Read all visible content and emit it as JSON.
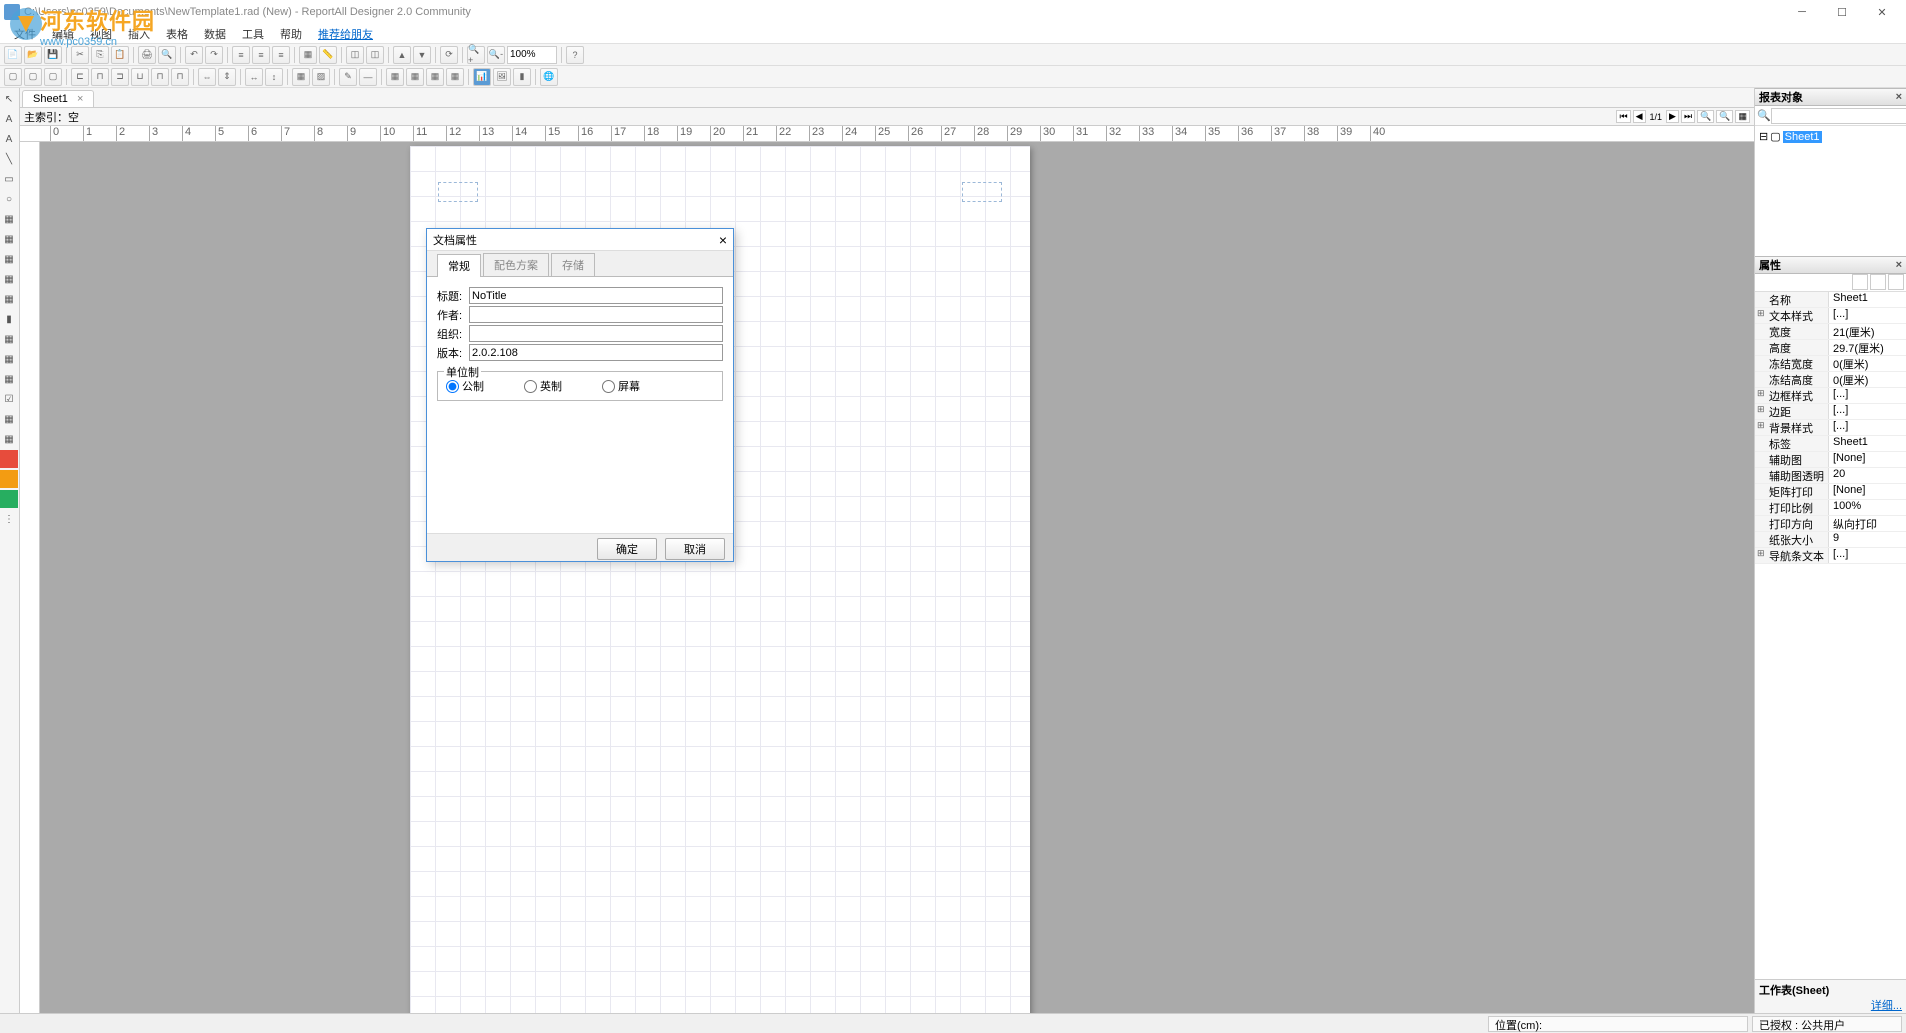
{
  "title": "C:\\Users\\pc0359\\Documents\\NewTemplate1.rad (New) - ReportAll Designer 2.0 Community",
  "watermark": {
    "line1": "河东软件园",
    "line2": "www.pc0359.cn"
  },
  "menu": {
    "file": "文件",
    "edit": "编辑",
    "view": "视图",
    "insert": "插入",
    "table": "表格",
    "data": "数据",
    "tool": "工具",
    "help": "帮助",
    "recommend": "推荐给朋友"
  },
  "toolbar": {
    "zoom": "100%"
  },
  "sheet_tab": "Sheet1",
  "index_bar": {
    "label": "主索引：",
    "value": "空",
    "page": "1/1"
  },
  "right": {
    "objects_title": "报表对象",
    "tree_root": "Sheet1",
    "props_title": "属性",
    "sheet_info": "工作表(Sheet)",
    "detail": "详细..."
  },
  "props": [
    {
      "k": "名称",
      "v": "Sheet1",
      "exp": false
    },
    {
      "k": "文本样式",
      "v": "[...]",
      "exp": true
    },
    {
      "k": "宽度",
      "v": "21(厘米)",
      "exp": false
    },
    {
      "k": "高度",
      "v": "29.7(厘米)",
      "exp": false
    },
    {
      "k": "冻结宽度",
      "v": "0(厘米)",
      "exp": false
    },
    {
      "k": "冻结高度",
      "v": "0(厘米)",
      "exp": false
    },
    {
      "k": "边框样式",
      "v": "[...]",
      "exp": true
    },
    {
      "k": "边距",
      "v": "[...]",
      "exp": true
    },
    {
      "k": "背景样式",
      "v": "[...]",
      "exp": true
    },
    {
      "k": "标签",
      "v": "Sheet1",
      "exp": false
    },
    {
      "k": "辅助图",
      "v": "[None]",
      "exp": false
    },
    {
      "k": "辅助图透明度",
      "v": "20",
      "exp": false
    },
    {
      "k": "矩阵打印",
      "v": "[None]",
      "exp": false
    },
    {
      "k": "打印比例",
      "v": "100%",
      "exp": false
    },
    {
      "k": "打印方向",
      "v": "纵向打印",
      "exp": false
    },
    {
      "k": "纸张大小",
      "v": "9",
      "exp": false
    },
    {
      "k": "导航条文本",
      "v": "[...]",
      "exp": true
    }
  ],
  "status": {
    "pos": "位置(cm):",
    "auth": "已授权 : 公共用户"
  },
  "dialog": {
    "title": "文档属性",
    "tabs": {
      "general": "常规",
      "palette": "配色方案",
      "save": "存储"
    },
    "labels": {
      "title": "标题:",
      "author": "作者:",
      "org": "组织:",
      "version": "版本:",
      "unit_group": "单位制",
      "metric": "公制",
      "imperial": "英制",
      "screen": "屏幕"
    },
    "values": {
      "title": "NoTitle",
      "author": "",
      "org": "",
      "version": "2.0.2.108"
    },
    "buttons": {
      "ok": "确定",
      "cancel": "取消"
    }
  }
}
